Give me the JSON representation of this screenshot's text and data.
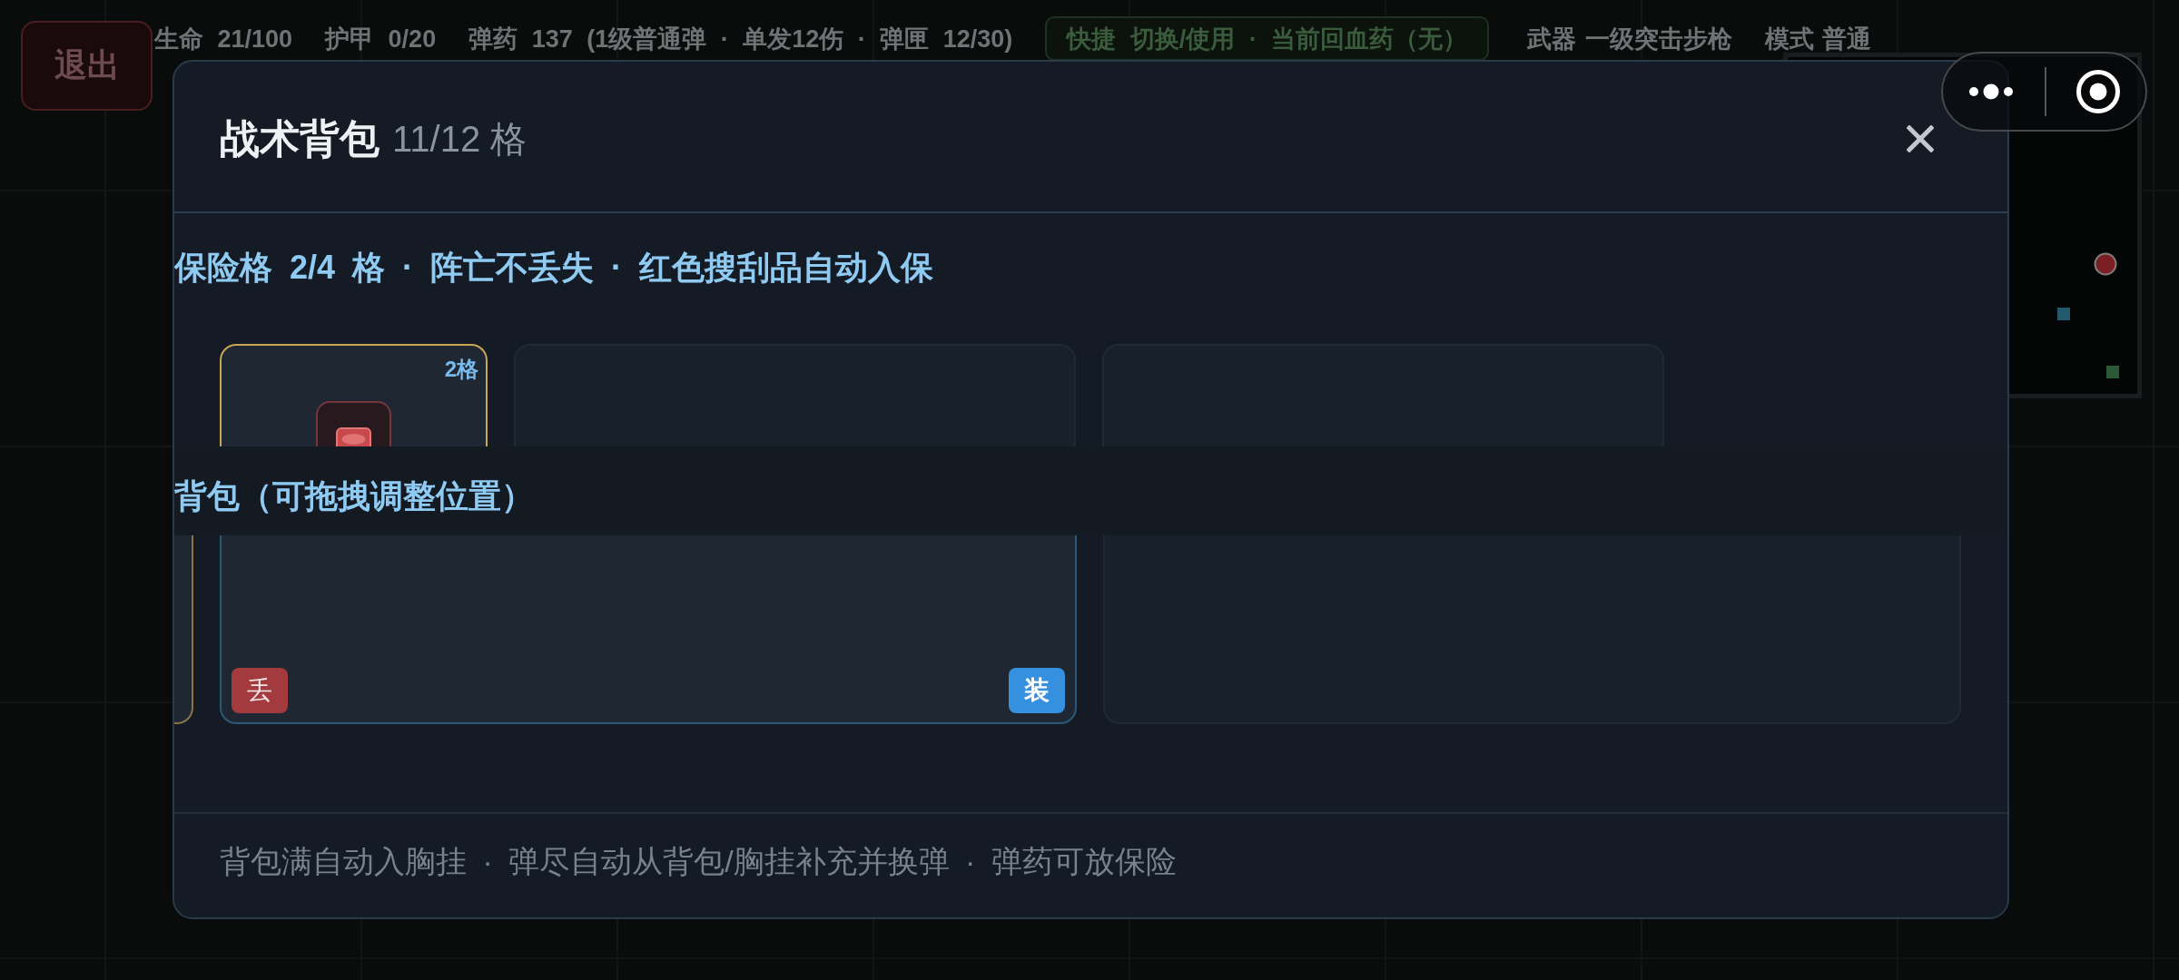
{
  "hud": {
    "exit_button": "退出",
    "stats": [
      "生命 21/100",
      "护甲 0/20",
      "弹药 137 (1级普通弹 · 单发12伤 · 弹匣 12/30)"
    ],
    "quick_bar": "快捷 切换/使用 · 当前回血药（无）",
    "weapon": "武器 一级突击步枪",
    "mode": "模式 普通"
  },
  "minimap": {
    "markers": [
      {
        "kind": "circle",
        "color": "#7b1f24"
      },
      {
        "kind": "square",
        "color": "#22596b"
      },
      {
        "kind": "square",
        "color": "#2a5a35"
      }
    ]
  },
  "modal": {
    "title": "战术背包",
    "capacity": "11/12 格",
    "insurance": {
      "label": "保险格 2/4 格 · 阵亡不丢失 · 红色搜刮品自动入保",
      "slots": [
        {
          "kind": "item",
          "color": "#c9a651",
          "size": "2格"
        },
        {
          "kind": "empty"
        },
        {
          "kind": "empty"
        }
      ]
    },
    "backpack": {
      "label": "背包（可拖拽调整位置）",
      "slots": [
        {
          "kind": "item",
          "color": "#8a7548"
        },
        {
          "kind": "item",
          "color": "#2c5878",
          "actions": [
            {
              "kind": "drop",
              "label": "丢"
            },
            {
              "kind": "equip",
              "label": "装"
            }
          ]
        },
        {
          "kind": "empty"
        }
      ]
    },
    "footer": "背包满自动入胸挂 · 弹尽自动从背包/胸挂补充并换弹 · 弹药可放保险"
  }
}
